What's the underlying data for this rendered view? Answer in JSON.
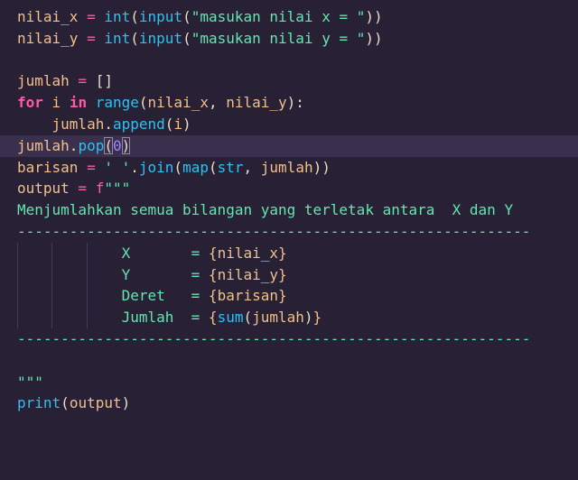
{
  "editor": {
    "lines": [
      [
        {
          "t": "nilai_x",
          "c": "var"
        },
        {
          "t": " = ",
          "c": "op"
        },
        {
          "t": "int",
          "c": "fn"
        },
        {
          "t": "(",
          "c": "punc"
        },
        {
          "t": "input",
          "c": "fn"
        },
        {
          "t": "(",
          "c": "punc"
        },
        {
          "t": "\"masukan nilai x = \"",
          "c": "str"
        },
        {
          "t": "))",
          "c": "punc"
        }
      ],
      [
        {
          "t": "nilai_y",
          "c": "var"
        },
        {
          "t": " = ",
          "c": "op"
        },
        {
          "t": "int",
          "c": "fn"
        },
        {
          "t": "(",
          "c": "punc"
        },
        {
          "t": "input",
          "c": "fn"
        },
        {
          "t": "(",
          "c": "punc"
        },
        {
          "t": "\"masukan nilai y = \"",
          "c": "str"
        },
        {
          "t": "))",
          "c": "punc"
        }
      ],
      [],
      [
        {
          "t": "jumlah",
          "c": "var"
        },
        {
          "t": " = ",
          "c": "op"
        },
        {
          "t": "[]",
          "c": "punc"
        }
      ],
      [
        {
          "t": "for",
          "c": "kw"
        },
        {
          "t": " i ",
          "c": "var"
        },
        {
          "t": "in",
          "c": "kw"
        },
        {
          "t": " ",
          "c": "punc"
        },
        {
          "t": "range",
          "c": "fn"
        },
        {
          "t": "(",
          "c": "punc"
        },
        {
          "t": "nilai_x",
          "c": "var"
        },
        {
          "t": ", ",
          "c": "punc"
        },
        {
          "t": "nilai_y",
          "c": "var"
        },
        {
          "t": "):",
          "c": "punc"
        }
      ],
      [
        {
          "t": "    ",
          "c": "punc"
        },
        {
          "t": "jumlah",
          "c": "var"
        },
        {
          "t": ".",
          "c": "punc"
        },
        {
          "t": "append",
          "c": "fn"
        },
        {
          "t": "(",
          "c": "punc"
        },
        {
          "t": "i",
          "c": "var"
        },
        {
          "t": ")",
          "c": "punc"
        }
      ],
      [
        {
          "t": "jumlah",
          "c": "var"
        },
        {
          "t": ".",
          "c": "punc"
        },
        {
          "t": "pop",
          "c": "fn"
        },
        {
          "t": "(",
          "c": "punc",
          "m": 1
        },
        {
          "t": "0",
          "c": "num"
        },
        {
          "t": ")",
          "c": "punc",
          "m": 1
        }
      ],
      [
        {
          "t": "barisan",
          "c": "var"
        },
        {
          "t": " = ",
          "c": "op"
        },
        {
          "t": "' '",
          "c": "str"
        },
        {
          "t": ".",
          "c": "punc"
        },
        {
          "t": "join",
          "c": "fn"
        },
        {
          "t": "(",
          "c": "punc"
        },
        {
          "t": "map",
          "c": "fn"
        },
        {
          "t": "(",
          "c": "punc"
        },
        {
          "t": "str",
          "c": "fn"
        },
        {
          "t": ", ",
          "c": "punc"
        },
        {
          "t": "jumlah",
          "c": "var"
        },
        {
          "t": "))",
          "c": "punc"
        }
      ],
      [
        {
          "t": "output",
          "c": "var"
        },
        {
          "t": " = ",
          "c": "op"
        },
        {
          "t": "f",
          "c": "op"
        },
        {
          "t": "\"\"\"",
          "c": "str"
        }
      ],
      [
        {
          "t": "Menjumlahkan semua bilangan yang terletak antara  X dan Y",
          "c": "str"
        }
      ],
      [
        {
          "t": "-----------------------------------------------------------",
          "c": "str"
        }
      ],
      [
        {
          "t": "            X       = ",
          "c": "str"
        },
        {
          "t": "{",
          "c": "brace"
        },
        {
          "t": "nilai_x",
          "c": "var"
        },
        {
          "t": "}",
          "c": "brace"
        }
      ],
      [
        {
          "t": "            Y       = ",
          "c": "str"
        },
        {
          "t": "{",
          "c": "brace"
        },
        {
          "t": "nilai_y",
          "c": "var"
        },
        {
          "t": "}",
          "c": "brace"
        }
      ],
      [
        {
          "t": "            Deret   = ",
          "c": "str"
        },
        {
          "t": "{",
          "c": "brace"
        },
        {
          "t": "barisan",
          "c": "var"
        },
        {
          "t": "}",
          "c": "brace"
        }
      ],
      [
        {
          "t": "            Jumlah  = ",
          "c": "str"
        },
        {
          "t": "{",
          "c": "brace"
        },
        {
          "t": "sum",
          "c": "fn"
        },
        {
          "t": "(",
          "c": "punc"
        },
        {
          "t": "jumlah",
          "c": "var"
        },
        {
          "t": ")",
          "c": "punc"
        },
        {
          "t": "}",
          "c": "brace"
        }
      ],
      [
        {
          "t": "-----------------------------------------------------------",
          "c": "str"
        }
      ],
      [],
      [
        {
          "t": "\"\"\"",
          "c": "str"
        }
      ],
      [
        {
          "t": "print",
          "c": "fn"
        },
        {
          "t": "(",
          "c": "punc"
        },
        {
          "t": "output",
          "c": "var"
        },
        {
          "t": ")",
          "c": "punc"
        }
      ]
    ]
  }
}
